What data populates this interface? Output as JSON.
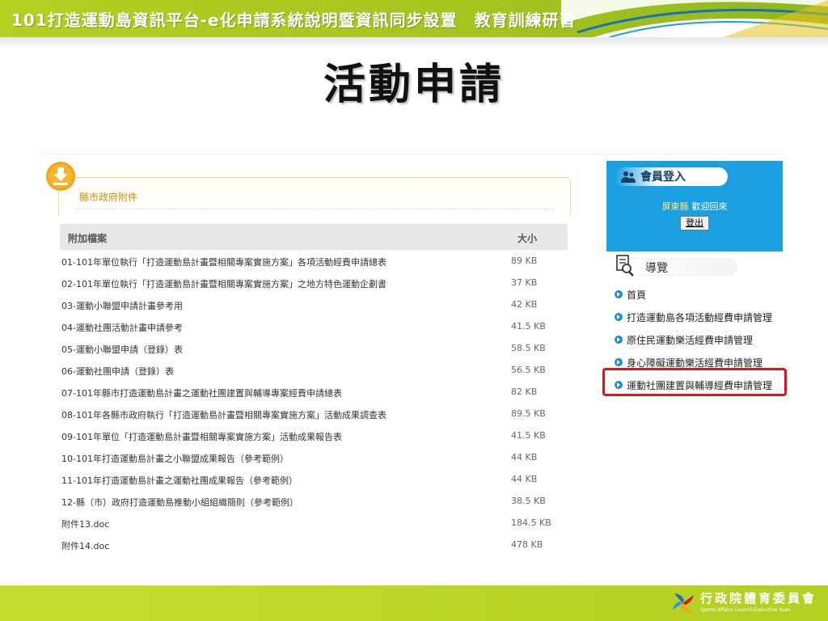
{
  "banner": {
    "title": "101打造運動島資訊平台-e化申請系統說明暨資訊同步設置　教育訓練研習"
  },
  "slide": {
    "title": "活動申請"
  },
  "attachments": {
    "section_title": "縣市政府附件",
    "header_name": "附加檔案",
    "header_size": "大小",
    "rows": [
      {
        "name": "01-101年單位執行「打造運動島計畫暨相關專案實施方案」各項活動經費申請總表",
        "size": "89 KB"
      },
      {
        "name": "02-101年單位執行「打造運動島計畫暨相關專案實施方案」之地方特色運動企劃書",
        "size": "37 KB"
      },
      {
        "name": "03-運動小聯盟申請計畫參考用",
        "size": "42 KB"
      },
      {
        "name": "04-運動社團活動計畫申請參考",
        "size": "41.5 KB"
      },
      {
        "name": "05-運動小聯盟申請（登錄）表",
        "size": "58.5 KB"
      },
      {
        "name": "06-運動社團申請（登錄）表",
        "size": "56.5 KB"
      },
      {
        "name": "07-101年縣市打造運動島計畫之運動社團建置與輔導專案經費申請總表",
        "size": "82 KB"
      },
      {
        "name": "08-101年各縣市政府執行「打造運動島計畫暨相關專案實施方案」活動成果調查表",
        "size": "89.5 KB"
      },
      {
        "name": "09-101年單位「打造運動島計畫暨相關專案實施方案」活動成果報告表",
        "size": "41.5 KB"
      },
      {
        "name": "10-101年打造運動島計畫之小聯盟成果報告（參考範例）",
        "size": "44 KB"
      },
      {
        "name": "11-101年打造運動島計畫之運動社團成果報告（參考範例）",
        "size": "44 KB"
      },
      {
        "name": "12-縣（市）政府打造運動島推動小組組織簡則（參考範例）",
        "size": "38.5 KB"
      },
      {
        "name": "附件13.doc",
        "size": "184.5 KB"
      },
      {
        "name": "附件14.doc",
        "size": "478 KB"
      }
    ]
  },
  "member": {
    "label": "會員登入",
    "county": "屏東縣",
    "welcome": "歡迎回來",
    "logout_label": "登出"
  },
  "nav": {
    "label": "導覽",
    "items": [
      {
        "label": "首頁"
      },
      {
        "label": "打造運動島各項活動經費申請管理"
      },
      {
        "label": "原住民運動樂活經費申請管理"
      },
      {
        "label": "身心障礙運動樂活經費申請管理"
      },
      {
        "label": "運動社團建置與輔導經費申請管理"
      }
    ]
  },
  "footer": {
    "org_name": "行政院體育委員會",
    "org_en": "Sports Affairs Council,Executive Yuan"
  },
  "colors": {
    "banner_green": "#a4c41e",
    "sidebar_blue": "#1a9fe0",
    "section_orange": "#e08a0a",
    "highlight_red": "#e01515"
  }
}
